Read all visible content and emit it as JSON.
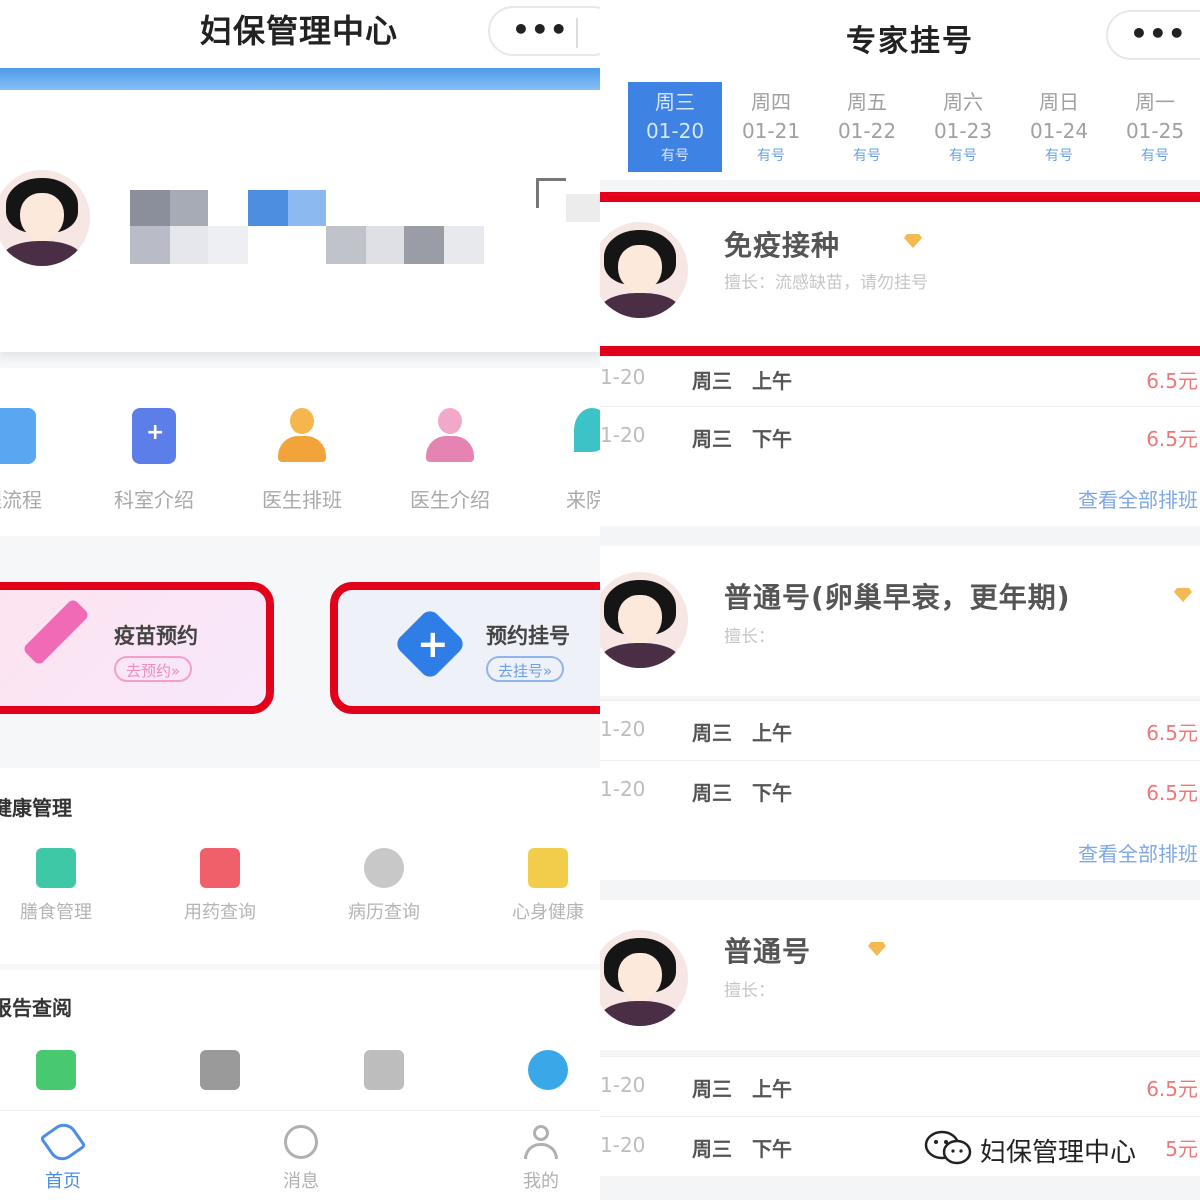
{
  "left": {
    "nav": {
      "title": "妇保管理中心",
      "more_glyph": "•••"
    },
    "quick_links": [
      "程流程",
      "科室介绍",
      "医生排班",
      "医生介绍",
      "来院"
    ],
    "cards": [
      {
        "title": "疫苗预约",
        "button": "去预约»"
      },
      {
        "title": "预约挂号",
        "button": "去挂号»"
      }
    ],
    "health": {
      "title": "健康管理",
      "items": [
        "膳食管理",
        "用药查询",
        "病历查询",
        "心身健康"
      ]
    },
    "reports": {
      "title": "报告查阅",
      "items": [
        "",
        "",
        "",
        ""
      ]
    },
    "tabs": [
      "首页",
      "消息",
      "我的"
    ]
  },
  "right": {
    "nav": {
      "title": "专家挂号",
      "more_glyph": "•••"
    },
    "dates": [
      {
        "week": "周三",
        "date": "01-20",
        "status": "有号",
        "active": true
      },
      {
        "week": "周四",
        "date": "01-21",
        "status": "有号",
        "active": false
      },
      {
        "week": "周五",
        "date": "01-22",
        "status": "有号",
        "active": false
      },
      {
        "week": "周六",
        "date": "01-23",
        "status": "有号",
        "active": false
      },
      {
        "week": "周日",
        "date": "01-24",
        "status": "有号",
        "active": false
      },
      {
        "week": "周一",
        "date": "01-25",
        "status": "有号",
        "active": false
      }
    ],
    "doctors": [
      {
        "name": "免疫接种",
        "desc": "擅长：流感缺苗，请勿挂号",
        "slots": [
          {
            "date": "1-20",
            "day": "周三",
            "part": "上午",
            "price": "6.5元"
          },
          {
            "date": "1-20",
            "day": "周三",
            "part": "下午",
            "price": "6.5元"
          }
        ],
        "more": "查看全部排班"
      },
      {
        "name": "普通号(卵巢早衰，更年期)",
        "desc": "擅长：",
        "slots": [
          {
            "date": "1-20",
            "day": "周三",
            "part": "上午",
            "price": "6.5元"
          },
          {
            "date": "1-20",
            "day": "周三",
            "part": "下午",
            "price": "6.5元"
          }
        ],
        "more": "查看全部排班"
      },
      {
        "name": "普通号",
        "desc": "擅长：",
        "slots": [
          {
            "date": "1-20",
            "day": "周三",
            "part": "上午",
            "price": "6.5元"
          },
          {
            "date": "1-20",
            "day": "周三",
            "part": "下午",
            "price": "5元"
          }
        ]
      }
    ]
  },
  "watermark": "妇保管理中心",
  "colors": {
    "highlight_red": "#e2001a",
    "primary_blue": "#3e82e4",
    "price_red": "#e77777"
  }
}
